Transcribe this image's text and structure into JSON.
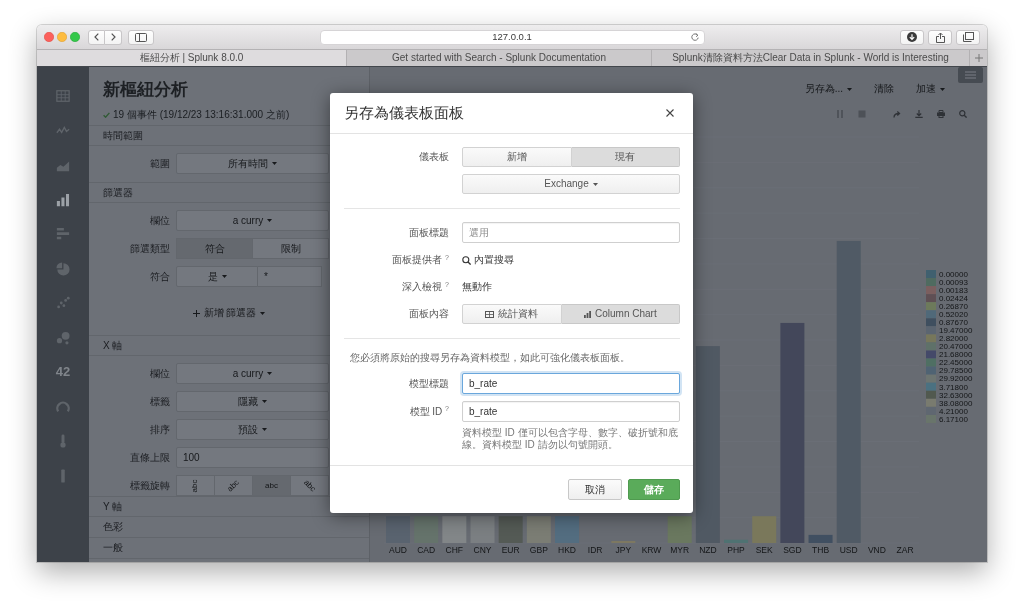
{
  "browser": {
    "address": "127.0.0.1",
    "tabs": [
      {
        "title": "樞紐分析 | Splunk 8.0.0",
        "selected": true
      },
      {
        "title": "Get started with Search - Splunk Documentation",
        "selected": false
      },
      {
        "title": "Splunk清除資料方法Clear Data in Splunk - World is Interesting",
        "selected": false
      }
    ]
  },
  "sidebar": {
    "items": [
      {
        "selected": false
      },
      {
        "selected": false
      },
      {
        "selected": false
      },
      {
        "selected": true
      },
      {
        "selected": false
      },
      {
        "selected": false
      },
      {
        "selected": false
      },
      {
        "selected": false
      },
      {
        "label": "42",
        "selected": false
      },
      {
        "selected": false
      },
      {
        "selected": false
      },
      {
        "selected": false
      }
    ]
  },
  "pivot": {
    "title": "新樞紐分析",
    "status": "19 個事件 (19/12/23 13:16:31.000 之前)",
    "sections": [
      {
        "title": "時間範圍",
        "fields": [
          {
            "kind": "dropdown",
            "label": "範圍",
            "value": "所有時間"
          }
        ]
      },
      {
        "title": "篩選器",
        "fields": [
          {
            "kind": "dropdown",
            "label": "欄位",
            "value": "a curry"
          },
          {
            "kind": "segmented",
            "label": "篩選類型",
            "options": [
              {
                "label": "符合",
                "selected": true
              },
              {
                "label": "限制",
                "selected": false
              }
            ]
          },
          {
            "kind": "match",
            "label": "符合",
            "value": "是",
            "input": "*"
          }
        ],
        "add_button": "新增 篩選器"
      },
      {
        "title": "X 軸",
        "fields": [
          {
            "kind": "dropdown",
            "label": "欄位",
            "value": "a curry"
          },
          {
            "kind": "dropdown",
            "label": "標籤",
            "value": "隱藏"
          },
          {
            "kind": "dropdown",
            "label": "排序",
            "value": "預設"
          },
          {
            "kind": "input",
            "label": "直條上限",
            "value": "100"
          },
          {
            "kind": "rotation",
            "label": "標籤旋轉",
            "options": [
              {
                "label": "abc",
                "selected": false
              },
              {
                "label": "abc",
                "selected": false
              },
              {
                "label": "abc",
                "selected": true
              },
              {
                "label": "abc",
                "selected": false
              }
            ]
          }
        ]
      },
      {
        "title": "Y 軸"
      },
      {
        "title": "色彩"
      },
      {
        "title": "一般"
      }
    ]
  },
  "header_actions": [
    {
      "label": "另存為...",
      "kind": "dropdown"
    },
    {
      "label": "清除",
      "kind": "link"
    },
    {
      "label": "加速",
      "kind": "dropdown"
    }
  ],
  "chart_tools": [
    {
      "disabled": true
    },
    {
      "disabled": true
    },
    {
      "disabled": false
    },
    {
      "disabled": false
    },
    {
      "disabled": false
    },
    {
      "disabled": false
    }
  ],
  "chart": {
    "categories": [
      {
        "label": "AUD",
        "color": "#59636f"
      },
      {
        "label": "CAD",
        "color": "#65736b"
      },
      {
        "label": "CHF",
        "color": "#828688"
      },
      {
        "label": "CNY",
        "color": "#7b7f82"
      },
      {
        "label": "EUR",
        "color": "#545a55"
      },
      {
        "label": "GBP",
        "color": "#7b7d74"
      },
      {
        "label": "HKD",
        "color": "#536d80"
      },
      {
        "label": "IDR"
      },
      {
        "label": "JPY",
        "color": "#7d7861"
      },
      {
        "label": "KRW"
      },
      {
        "label": "MYR",
        "color": "#6a785f"
      },
      {
        "label": "NZD",
        "color": "#505963"
      },
      {
        "label": "PHP",
        "color": "#4f7272"
      },
      {
        "label": "SEK",
        "color": "#7a785b"
      },
      {
        "label": "SGD",
        "color": "#43475a"
      },
      {
        "label": "THB",
        "color": "#404f61"
      },
      {
        "label": "USD",
        "color": "#505a65"
      },
      {
        "label": "VND"
      },
      {
        "label": "ZAR"
      }
    ],
    "legend": [
      {
        "label": "0.00000",
        "color": "#40606f"
      },
      {
        "label": "0.00093",
        "color": "#4f6b60"
      },
      {
        "label": "0.00183",
        "color": "#7b5f5f"
      },
      {
        "label": "0.02424",
        "color": "#5f4f54"
      },
      {
        "label": "0.26870",
        "color": "#6d7a5b"
      },
      {
        "label": "0.52020",
        "color": "#506979"
      },
      {
        "label": "0.87670",
        "color": "#3f4f5f"
      },
      {
        "label": "19.47000",
        "color": "#5b6571"
      },
      {
        "label": "2.82000",
        "color": "#77775b"
      },
      {
        "label": "20.47000",
        "color": "#5f7169"
      },
      {
        "label": "21.68000",
        "color": "#444969"
      },
      {
        "label": "22.45000",
        "color": "#4f6f63"
      },
      {
        "label": "29.78500",
        "color": "#4f6373"
      },
      {
        "label": "29.92000",
        "color": "#6d7571"
      },
      {
        "label": "3.71800",
        "color": "#4b7181"
      },
      {
        "label": "32.63000",
        "color": "#51594f"
      },
      {
        "label": "38.08000",
        "color": "#797b6f"
      },
      {
        "label": "4.21000",
        "color": "#5f6771"
      },
      {
        "label": "6.17100",
        "color": "#69756b"
      }
    ]
  },
  "dialog": {
    "title": "另存為儀表板面板",
    "sections": [
      {
        "rows": [
          {
            "kind": "segmented",
            "label": "儀表板",
            "options": [
              {
                "label": "新增",
                "selected": false
              },
              {
                "label": "現有",
                "selected": true
              }
            ]
          },
          {
            "kind": "dropdown",
            "value": "Exchange"
          }
        ]
      },
      {
        "rows": [
          {
            "kind": "input",
            "label": "面板標題",
            "placeholder": "選用",
            "focused": false
          },
          {
            "kind": "search_text",
            "label": "面板提供者 $^{?}$",
            "value": "內置搜尋"
          },
          {
            "kind": "text",
            "label": "深入檢視 $^{?}$",
            "value": "無動作"
          },
          {
            "kind": "view_switch",
            "label": "面板內容",
            "options": [
              {
                "label": "統計資料",
                "selected": false
              },
              {
                "label": "Column Chart",
                "selected": true
              }
            ]
          }
        ]
      },
      {
        "rows": [
          {
            "kind": "note",
            "text": "您必須將原始的搜尋另存為資料模型，如此可強化儀表板面板。"
          },
          {
            "kind": "input",
            "label": "模型標題",
            "value": "b_rate",
            "focused": true
          },
          {
            "kind": "input",
            "label": "模型 ID $^{?}$",
            "value": "b_rate",
            "focused": false,
            "help": "資料模型 ID 僅可以包含字母、數字、破折號和底線。資料模型 ID 請勿以句號開頭。"
          }
        ]
      }
    ],
    "buttons": [
      {
        "label": "取消",
        "kind": "secondary"
      },
      {
        "label": "儲存",
        "kind": "primary"
      }
    ]
  }
}
